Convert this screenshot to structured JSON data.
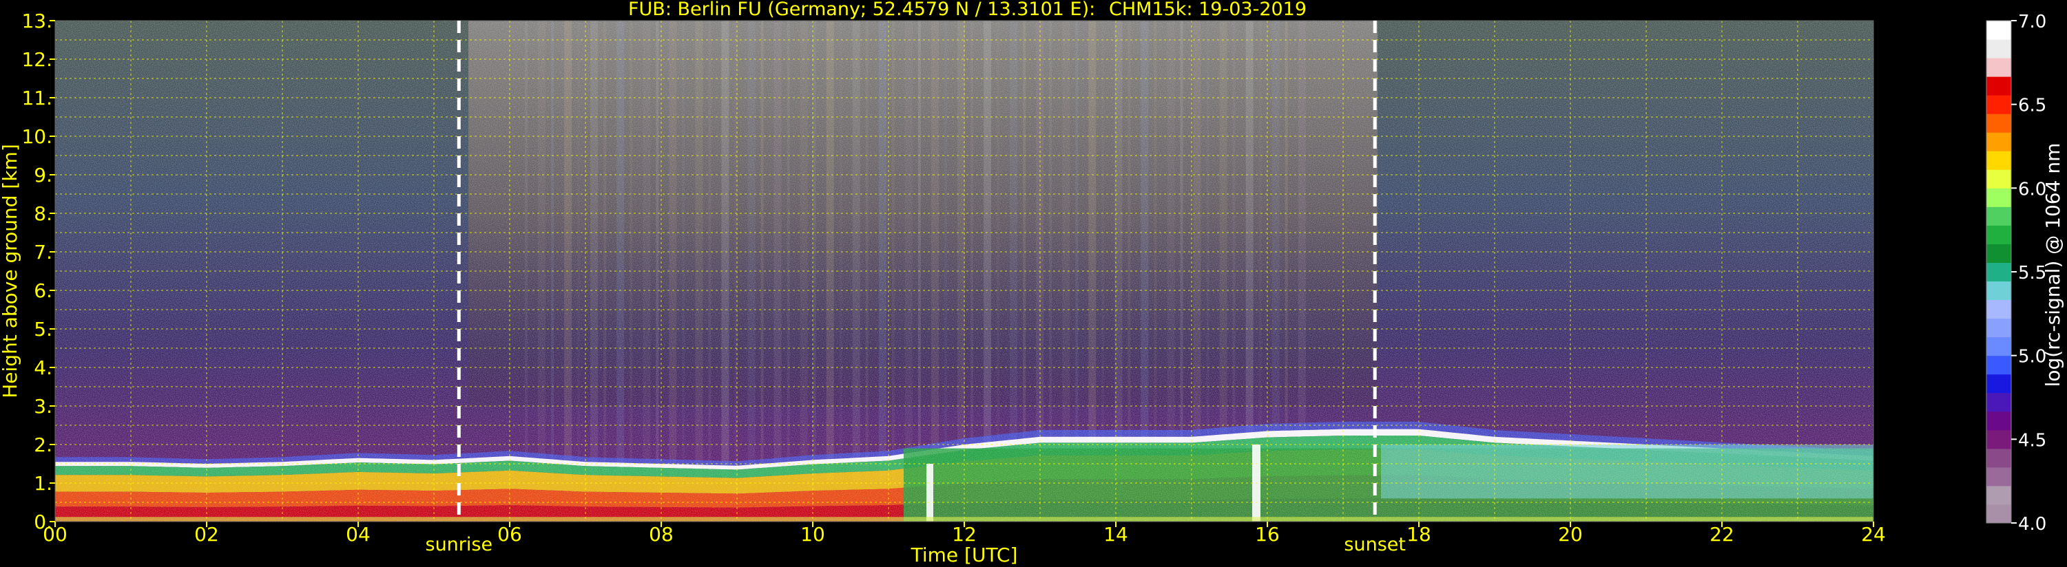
{
  "chart_data": {
    "type": "heatmap",
    "title_left": "FUB: Berlin FU (Germany; 52.4579 N / 13.3101 E):",
    "title_right": "CHM15k: 19-03-2019",
    "xlabel": "Time [UTC]",
    "ylabel": "Height above ground [km]",
    "xlim": [
      0,
      24
    ],
    "ylim": [
      0,
      13
    ],
    "x_ticks": [
      "00",
      "02",
      "04",
      "06",
      "08",
      "10",
      "12",
      "14",
      "16",
      "18",
      "20",
      "22",
      "24"
    ],
    "y_ticks": [
      "0.",
      "1.",
      "2.",
      "3.",
      "4.",
      "5.",
      "6.",
      "7.",
      "8.",
      "9.",
      "10.",
      "11.",
      "12.",
      "13."
    ],
    "grid": true,
    "markers": [
      {
        "label": "sunrise",
        "time": 5.33
      },
      {
        "label": "sunset",
        "time": 17.42
      }
    ],
    "colorbar": {
      "label": "log(rc-signal) @ 1064 nm",
      "range": [
        4.0,
        7.0
      ],
      "ticks": [
        "4.0",
        "4.5",
        "5.0",
        "5.5",
        "6.0",
        "6.5",
        "7.0"
      ],
      "colors": [
        "#a890a8",
        "#b09cb0",
        "#9a6a9a",
        "#8a4a8a",
        "#7a1a7a",
        "#6a0a8a",
        "#4a18b8",
        "#1818e0",
        "#3a5aff",
        "#6a8aff",
        "#8aa0ff",
        "#a8b8ff",
        "#70d0d8",
        "#20b088",
        "#109030",
        "#20b040",
        "#50d060",
        "#a0ff60",
        "#e8ff40",
        "#ffd800",
        "#ffa000",
        "#ff6000",
        "#ff2000",
        "#e00000",
        "#f4c4c8",
        "#ececec",
        "#ffffff"
      ]
    },
    "boundary_layer_top_km": [
      [
        0,
        1.55
      ],
      [
        1,
        1.55
      ],
      [
        2,
        1.5
      ],
      [
        3,
        1.55
      ],
      [
        4,
        1.65
      ],
      [
        5,
        1.6
      ],
      [
        6,
        1.7
      ],
      [
        7,
        1.55
      ],
      [
        8,
        1.5
      ],
      [
        9,
        1.45
      ],
      [
        10,
        1.6
      ],
      [
        11,
        1.7
      ],
      [
        12,
        2.0
      ],
      [
        13,
        2.2
      ],
      [
        14,
        2.2
      ],
      [
        15,
        2.2
      ],
      [
        16,
        2.35
      ],
      [
        17,
        2.4
      ],
      [
        18,
        2.4
      ],
      [
        19,
        2.2
      ],
      [
        20,
        2.1
      ],
      [
        21,
        2.0
      ],
      [
        22,
        1.9
      ],
      [
        23,
        1.8
      ],
      [
        24,
        1.7
      ]
    ]
  }
}
